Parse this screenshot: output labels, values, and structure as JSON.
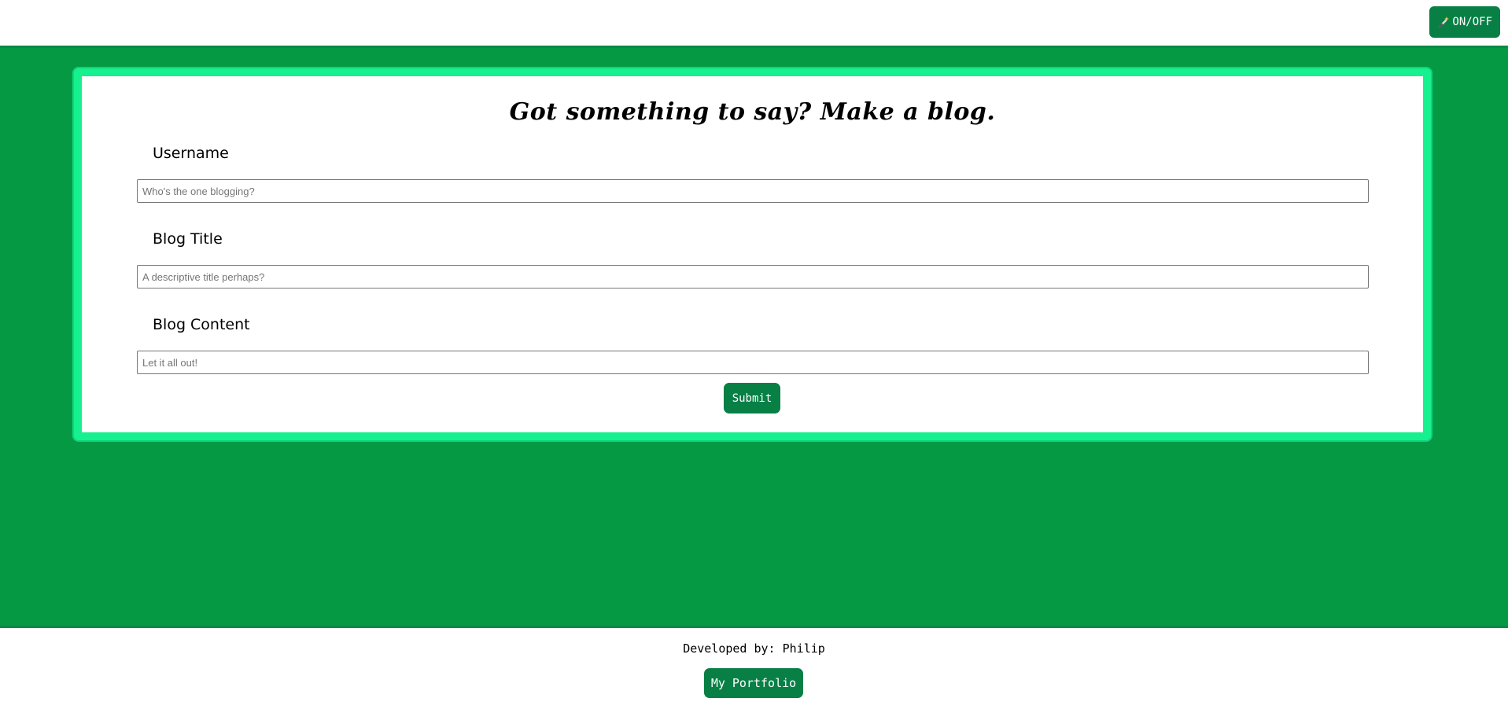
{
  "header": {
    "toggle_label": "ON/OFF",
    "toggle_icon": "magic-wand-icon"
  },
  "form": {
    "title": "Got something to say? Make a blog.",
    "fields": [
      {
        "label": "Username",
        "placeholder": "Who's the one blogging?",
        "value": ""
      },
      {
        "label": "Blog Title",
        "placeholder": "A descriptive title perhaps?",
        "value": ""
      },
      {
        "label": "Blog Content",
        "placeholder": "Let it all out!",
        "value": ""
      }
    ],
    "submit_label": "Submit"
  },
  "footer": {
    "developer_text": "Developed by: Philip",
    "portfolio_label": "My Portfolio"
  },
  "colors": {
    "page_green": "#069944",
    "card_border": "#16f08e",
    "button_green": "#087f45"
  }
}
